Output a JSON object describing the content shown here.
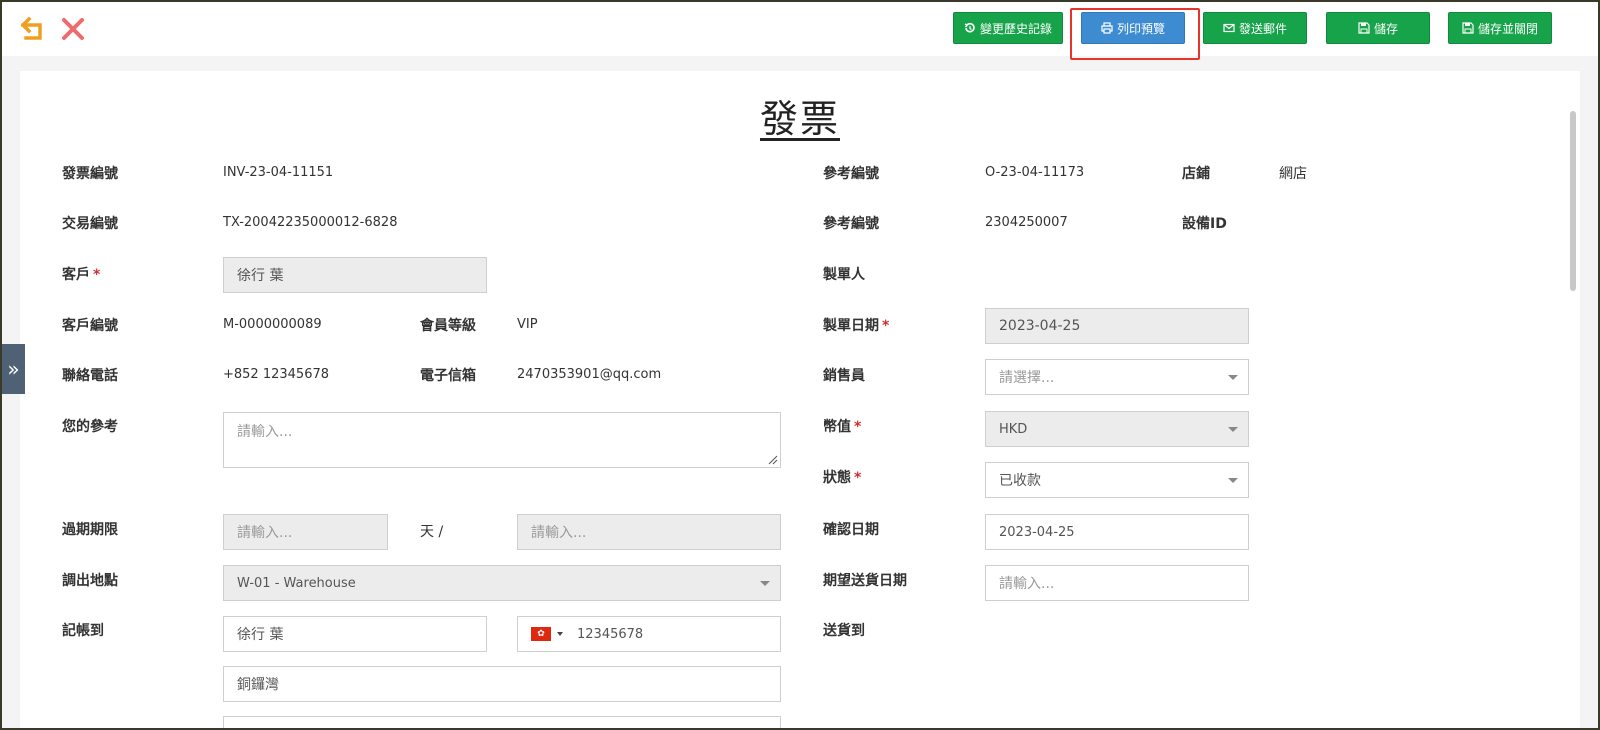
{
  "toolbar": {
    "history_label": "變更歷史記錄",
    "print_label": "列印預覽",
    "email_label": "發送郵件",
    "save_label": "儲存",
    "save_close_label": "儲存並關閉",
    "colors": {
      "green": "#17a34a",
      "blue": "#3d8cd1",
      "highlight": "#e8332a",
      "undo": "#f0a020",
      "close": "#ef6b6b"
    }
  },
  "form": {
    "title": "發票",
    "invoice_no": {
      "label": "發票編號",
      "value": "INV-23-04-11151"
    },
    "ref_no_1": {
      "label": "參考編號",
      "value": "O-23-04-11173"
    },
    "shop": {
      "label": "店鋪",
      "value": "網店"
    },
    "transaction_no": {
      "label": "交易編號",
      "value": "TX-20042235000012-6828"
    },
    "ref_no_2": {
      "label": "參考編號",
      "value": "2304250007"
    },
    "device_id": {
      "label": "設備ID",
      "value": ""
    },
    "customer": {
      "label": "客戶",
      "required": "*",
      "value": "徐行 葉"
    },
    "creator": {
      "label": "製單人",
      "value": ""
    },
    "customer_no": {
      "label": "客戶編號",
      "value": "M-0000000089"
    },
    "member_level": {
      "label": "會員等級",
      "value": "VIP"
    },
    "created_date": {
      "label": "製單日期",
      "required": "*",
      "value": "2023-04-25"
    },
    "phone": {
      "label": "聯絡電話",
      "value": "+852 12345678"
    },
    "email": {
      "label": "電子信箱",
      "value": "2470353901@qq.com"
    },
    "salesperson": {
      "label": "銷售員",
      "placeholder": "請選擇..."
    },
    "your_ref": {
      "label": "您的參考",
      "placeholder": "請輸入..."
    },
    "currency": {
      "label": "幣值",
      "required": "*",
      "value": "HKD"
    },
    "status": {
      "label": "狀態",
      "required": "*",
      "value": "已收款"
    },
    "expiry": {
      "label": "過期期限",
      "placeholder_days": "請輸入...",
      "unit": "天 /",
      "placeholder_date": "請輸入..."
    },
    "confirm_date": {
      "label": "確認日期",
      "value": "2023-04-25"
    },
    "warehouse": {
      "label": "調出地點",
      "value": "W-01 - Warehouse"
    },
    "expected_delivery": {
      "label": "期望送貨日期",
      "placeholder": "請輸入..."
    },
    "bill_to": {
      "label": "記帳到",
      "name": "徐行 葉",
      "phone": "12345678",
      "address": "銅鑼灣"
    },
    "ship_to": {
      "label": "送貨到"
    }
  }
}
